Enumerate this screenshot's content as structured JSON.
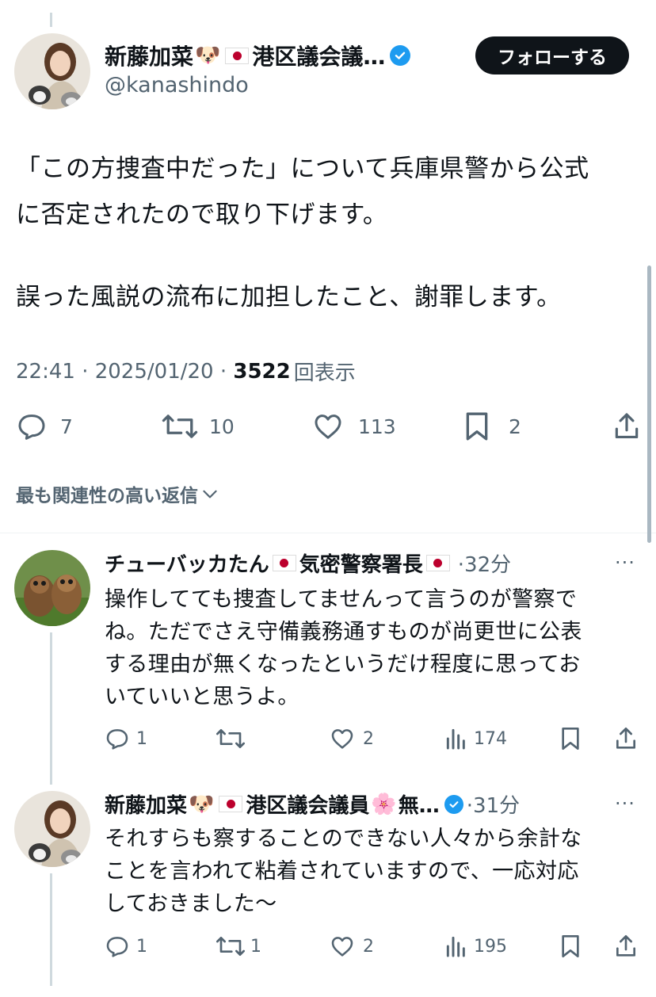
{
  "main_tweet": {
    "display_name": "新藤加菜",
    "name_suffix": "港区議会議…",
    "handle": "@kanashindo",
    "follow_label": "フォローする",
    "text_lines": [
      "「この方捜査中だった」について兵庫県警から公式",
      "に否定されたので取り下げます。",
      "",
      "誤った風説の流布に加担したこと、謝罪します。"
    ],
    "time": "22:41 · 2025/01/20 · ",
    "views_count": "3522",
    "views_label": "回表示",
    "actions": {
      "replies": "7",
      "retweets": "10",
      "likes": "113",
      "bookmarks": "2"
    }
  },
  "reply_sort_label": "最も関連性の高い返信",
  "replies": [
    {
      "display_name": "チューバッカたん",
      "name_middle": "気密警察署長",
      "time": "·32分",
      "text_lines": [
        "操作してても捜査してませんって言うのが警察で",
        "ね。ただでさえ守備義務通すものが尚更世に公表",
        "する理由が無くなったというだけ程度に思ってお",
        "いていいと思うよ。"
      ],
      "actions": {
        "replies": "1",
        "retweets": "",
        "likes": "2",
        "views": "174"
      }
    },
    {
      "display_name": "新藤加菜",
      "name_middle": "港区議会議員",
      "name_tail": "無…",
      "time": "·31分",
      "text_lines": [
        "それすらも察することのできない人々から余計な",
        "ことを言われて粘着されていますので、一応対応",
        "しておきました～"
      ],
      "actions": {
        "replies": "1",
        "retweets": "1",
        "likes": "2",
        "views": "195"
      }
    }
  ],
  "icons": [
    "reply-icon",
    "retweet-icon",
    "like-icon",
    "bookmark-icon",
    "share-icon",
    "views-icon",
    "more-icon",
    "verified-icon",
    "chevron-down-icon"
  ],
  "colors": {
    "accent": "#1d9bf0",
    "text": "#0f1419",
    "muted": "#536471",
    "flag_red": "#bc002d"
  }
}
